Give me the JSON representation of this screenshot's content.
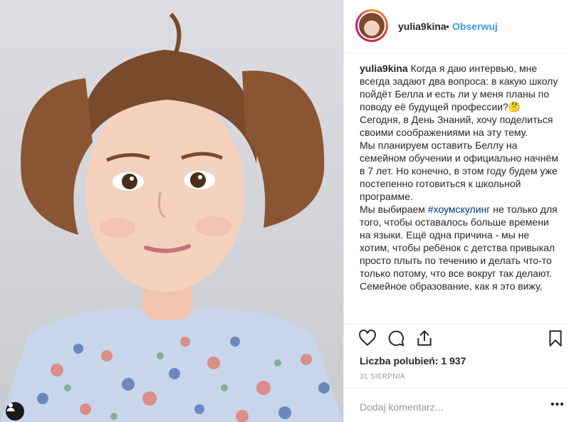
{
  "post": {
    "username": "yulia9kina",
    "separator": "•",
    "follow_label": "Obserwuj",
    "caption": {
      "user": "yulia9kina",
      "p1": " Когда я даю интервью, мне всегда задают два вопроса: в какую школу пойдёт Белла и есть ли у меня планы по поводу её будущей профессии?🤔 Сегодня, в День Знаний, хочу поделиться своими соображениями на эту тему.",
      "p2": "Мы планируем оставить Беллу на семейном обучении и официально начнём в 7 лет. Но конечно, в этом году будем уже постепенно готовиться к школьной программе.",
      "p3_before": "Мы выбираем ",
      "p3_hashtag": "#хоумскулинг",
      "p3_after": " не только для того, чтобы оставалось больше времени на языки. Ещё одна причина - мы не хотим, чтобы ребёнок с детства привыкал просто плыть по течению и делать что-то только потому, что все вокруг так делают.",
      "p4": "Семейное образование, как я это вижу,"
    },
    "likes_text": "Liczba polubień: 1 937",
    "date": "31 SIERPNIA",
    "comment_placeholder": "Dodaj komentarz...",
    "more_label": "•••"
  },
  "icons": {
    "like": "heart-icon",
    "comment": "comment-icon",
    "share": "share-icon",
    "save": "bookmark-icon",
    "tag": "user-tag-icon"
  }
}
